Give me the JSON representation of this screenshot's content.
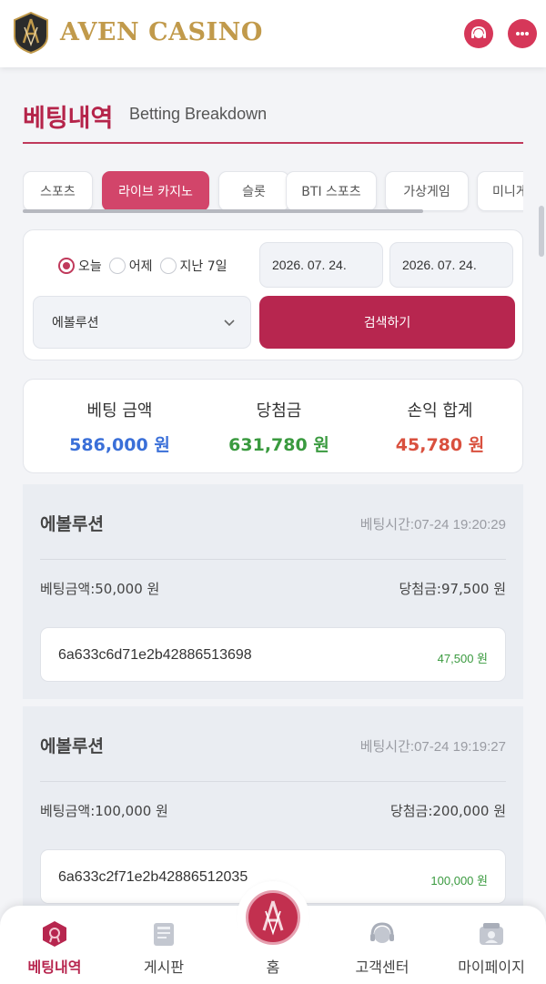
{
  "header": {
    "logo_text": "AVEN CASINO",
    "icons": [
      "support-icon",
      "chat-icon"
    ]
  },
  "page": {
    "title": "베팅내역",
    "subtitle": "Betting Breakdown"
  },
  "tabs": [
    {
      "label": "스포츠",
      "active": false
    },
    {
      "label": "라이브 카지노",
      "active": true
    },
    {
      "label": "슬롯",
      "active": false
    },
    {
      "label": "BTI 스포츠",
      "active": false
    },
    {
      "label": "가상게임",
      "active": false
    },
    {
      "label": "미니게",
      "active": false
    }
  ],
  "filter": {
    "radios": [
      {
        "label": "오늘",
        "checked": true
      },
      {
        "label": "어제",
        "checked": false
      },
      {
        "label": "지난 7일",
        "checked": false
      }
    ],
    "date_from": "2026. 07. 24.",
    "date_to": "2026. 07. 24.",
    "provider": "에볼루션",
    "search_label": "검색하기"
  },
  "summary": [
    {
      "label": "베팅 금액",
      "value": "586,000 원",
      "color": "#3a6fd8"
    },
    {
      "label": "당첨금",
      "value": "631,780 원",
      "color": "#3a9a3f"
    },
    {
      "label": "손익 합계",
      "value": "45,780 원",
      "color": "#d9503e"
    }
  ],
  "records": [
    {
      "provider": "에볼루션",
      "time": "베팅시간:07-24 19:20:29",
      "bet": "베팅금액:50,000 원",
      "win": "당첨금:97,500 원",
      "hash": "6a633c6d71e2b42886513698",
      "profit": "47,500 원"
    },
    {
      "provider": "에볼루션",
      "time": "베팅시간:07-24 19:19:27",
      "bet": "베팅금액:100,000 원",
      "win": "당첨금:200,000 원",
      "hash": "6a633c2f71e2b42886512035",
      "profit": "100,000 원"
    }
  ],
  "bottom_nav": [
    {
      "label": "베팅내역",
      "icon": "betting-history-icon",
      "active": true
    },
    {
      "label": "게시판",
      "icon": "board-icon",
      "active": false
    },
    {
      "label": "홈",
      "icon": "home-logo-icon",
      "active": false
    },
    {
      "label": "고객센터",
      "icon": "customer-center-icon",
      "active": false
    },
    {
      "label": "마이페이지",
      "icon": "my-page-icon",
      "active": false
    }
  ],
  "colors": {
    "brand": "#b7264f",
    "gold": "#c19a4b",
    "profit_green": "#3a9a3f"
  }
}
